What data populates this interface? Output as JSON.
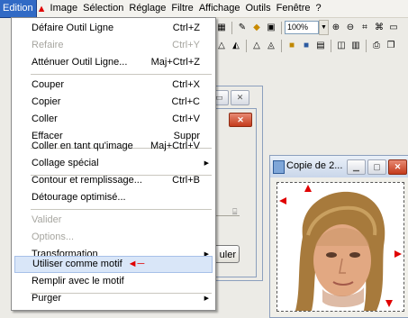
{
  "menubar": {
    "items": [
      "Edition",
      "Image",
      "Sélection",
      "Réglage",
      "Filtre",
      "Affichage",
      "Outils",
      "Fenêtre",
      "?"
    ]
  },
  "toolbar": {
    "zoom_value": "100%"
  },
  "edition_menu": {
    "items": [
      {
        "label": "Défaire Outil Ligne",
        "shortcut": "Ctrl+Z"
      },
      {
        "label": "Refaire",
        "shortcut": "Ctrl+Y"
      },
      {
        "label": "Atténuer Outil Ligne...",
        "shortcut": "Maj+Ctrl+Z"
      },
      {
        "label": "Couper",
        "shortcut": "Ctrl+X"
      },
      {
        "label": "Copier",
        "shortcut": "Ctrl+C"
      },
      {
        "label": "Coller",
        "shortcut": "Ctrl+V"
      },
      {
        "label": "Effacer",
        "shortcut": "Suppr"
      },
      {
        "label": "Coller en tant qu'image",
        "shortcut": "Maj+Ctrl+V"
      },
      {
        "label": "Collage spécial",
        "shortcut": ""
      },
      {
        "label": "Contour et remplissage...",
        "shortcut": "Ctrl+B"
      },
      {
        "label": "Détourage optimisé...",
        "shortcut": ""
      },
      {
        "label": "Valider",
        "shortcut": ""
      },
      {
        "label": "Options...",
        "shortcut": ""
      },
      {
        "label": "Transformation",
        "shortcut": ""
      },
      {
        "label": "Utiliser comme motif",
        "shortcut": ""
      },
      {
        "label": "Remplir avec le motif",
        "shortcut": ""
      },
      {
        "label": "Purger",
        "shortcut": ""
      }
    ]
  },
  "background_dialog": {
    "button_partial": "uler"
  },
  "photo_window": {
    "title": "Copie de 2..."
  },
  "colors": {
    "menu_highlight": "#316ac5",
    "annotation_red": "#e00000"
  }
}
